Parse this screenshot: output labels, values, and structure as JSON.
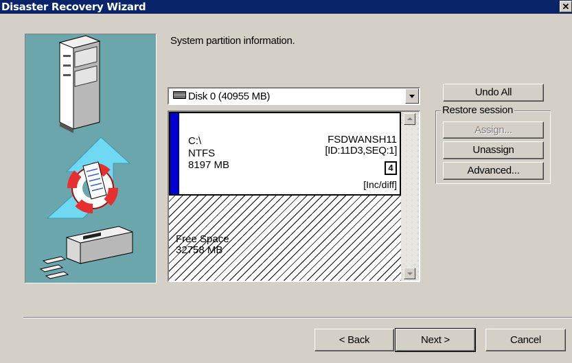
{
  "window": {
    "title": "Disaster Recovery Wizard",
    "close_glyph": "✕"
  },
  "heading": "System partition information.",
  "disk_combo": {
    "value": "Disk 0  (40955 MB)",
    "icon": "disk-icon"
  },
  "partitions": [
    {
      "drive": "C:\\",
      "filesystem": "NTFS",
      "size": "8197 MB",
      "label": "FSDWANSH11",
      "session_id": "[ID:11D3,SEQ:1]",
      "count": "4",
      "backup_type": "[Inc/diff]",
      "accent": "#0000cc"
    }
  ],
  "free_space": {
    "label": "Free Space",
    "size": "32758 MB"
  },
  "buttons": {
    "undo_all": "Undo All",
    "assign": "Assign...",
    "unassign": "Unassign",
    "advanced": "Advanced...",
    "back": "< Back",
    "next": "Next >",
    "cancel": "Cancel"
  },
  "restore_group_label": "Restore session",
  "colors": {
    "titlebar": "#0a246a",
    "face": "#d4d0c8",
    "illustration_bg": "#6aa6ac"
  }
}
